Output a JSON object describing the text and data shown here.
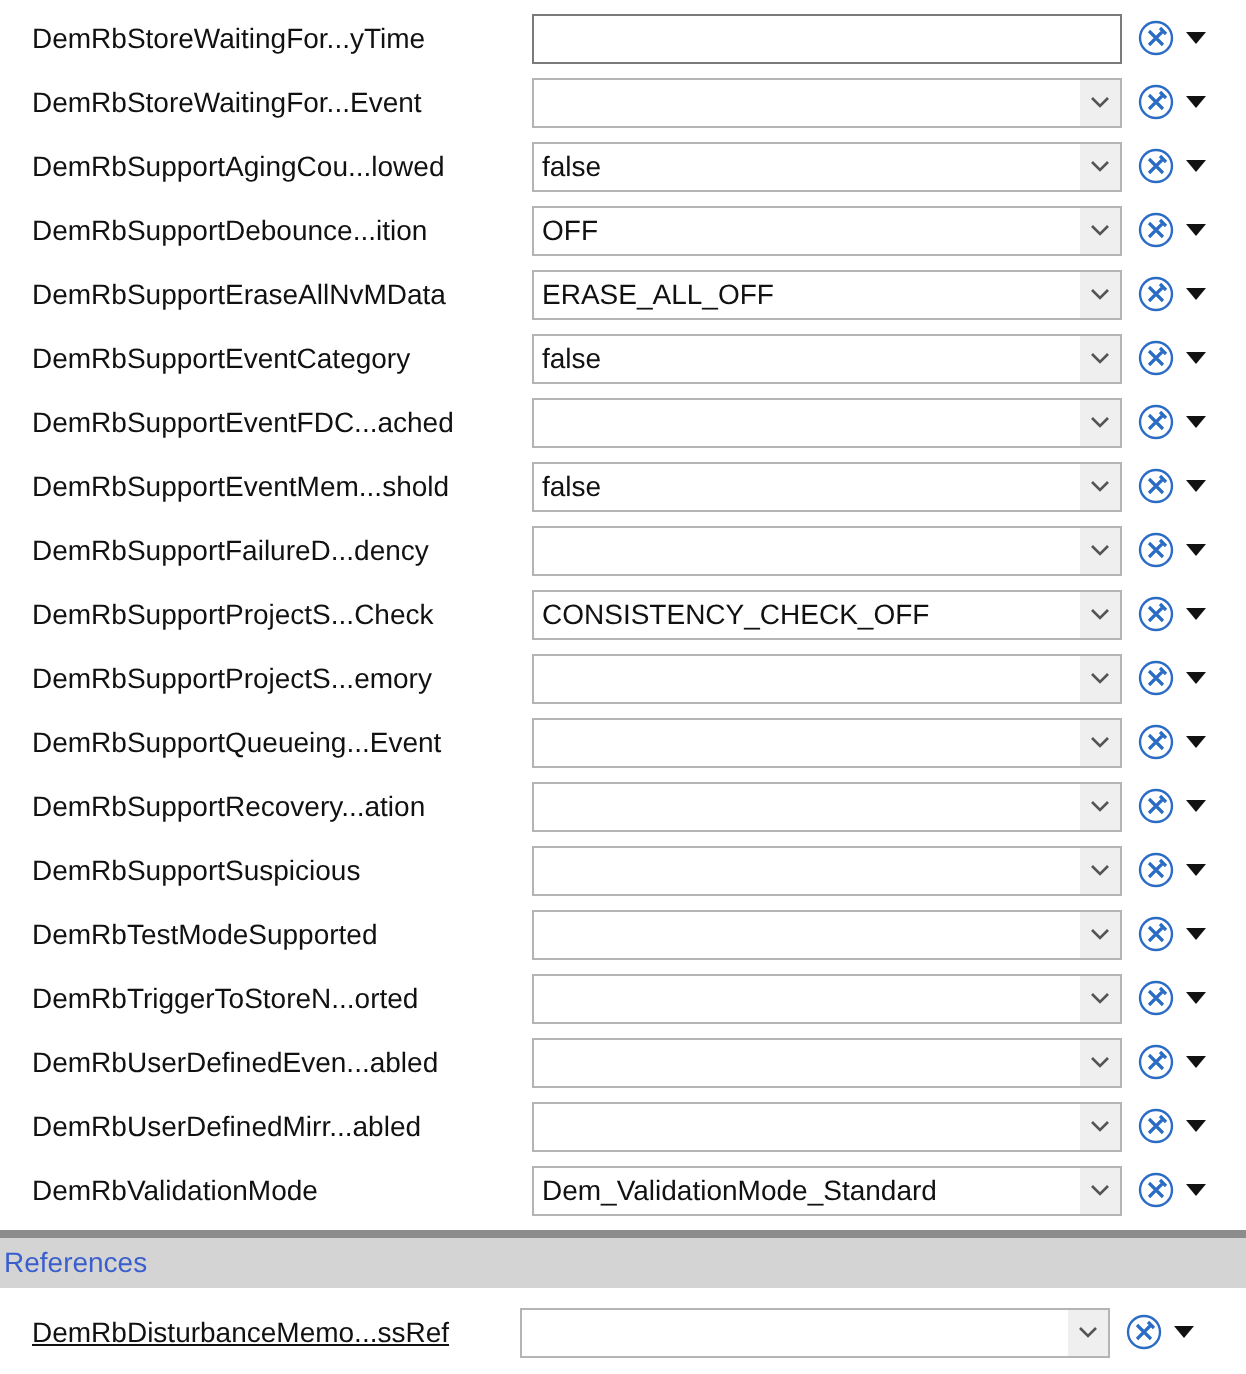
{
  "parameters": [
    {
      "label": "DemRbStoreWaitingFor...yTime",
      "kind": "text"
    },
    {
      "label": "DemRbStoreWaitingFor...Event",
      "kind": "combo"
    },
    {
      "label": "DemRbSupportAgingCou...lowed",
      "kind": "combo",
      "value": "false"
    },
    {
      "label": "DemRbSupportDebounce...ition",
      "kind": "combo",
      "value": "OFF"
    },
    {
      "label": "DemRbSupportEraseAllNvMData",
      "kind": "combo",
      "value": "ERASE_ALL_OFF"
    },
    {
      "label": "DemRbSupportEventCategory",
      "kind": "combo",
      "value": "false"
    },
    {
      "label": "DemRbSupportEventFDC...ached",
      "kind": "combo"
    },
    {
      "label": "DemRbSupportEventMem...shold",
      "kind": "combo",
      "value": "false"
    },
    {
      "label": "DemRbSupportFailureD...dency",
      "kind": "combo"
    },
    {
      "label": "DemRbSupportProjectS...Check",
      "kind": "combo",
      "value": "CONSISTENCY_CHECK_OFF"
    },
    {
      "label": "DemRbSupportProjectS...emory",
      "kind": "combo"
    },
    {
      "label": "DemRbSupportQueueing...Event",
      "kind": "combo"
    },
    {
      "label": "DemRbSupportRecovery...ation",
      "kind": "combo"
    },
    {
      "label": "DemRbSupportSuspicious",
      "kind": "combo"
    },
    {
      "label": "DemRbTestModeSupported",
      "kind": "combo"
    },
    {
      "label": "DemRbTriggerToStoreN...orted",
      "kind": "combo"
    },
    {
      "label": "DemRbUserDefinedEven...abled",
      "kind": "combo"
    },
    {
      "label": "DemRbUserDefinedMirr...abled",
      "kind": "combo"
    },
    {
      "label": "DemRbValidationMode",
      "kind": "combo",
      "value": "Dem_ValidationMode_Standard"
    }
  ],
  "references": {
    "title": "References",
    "items": [
      {
        "label": "DemRbDisturbanceMemo...ssRef",
        "kind": "combo"
      }
    ]
  }
}
